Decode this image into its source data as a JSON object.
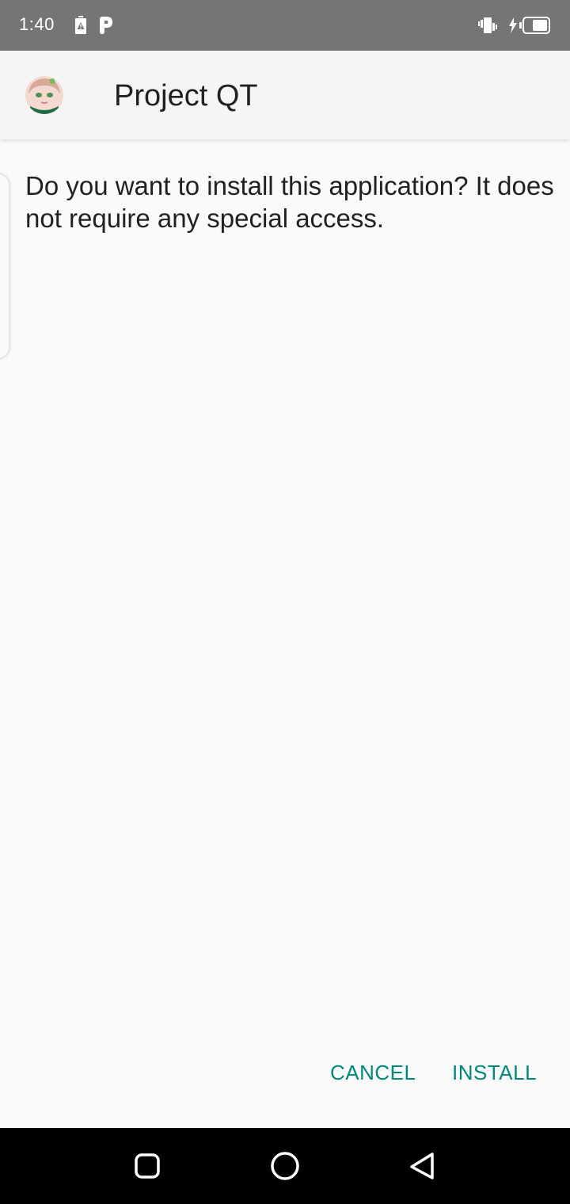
{
  "status_bar": {
    "time": "1:40",
    "icons": [
      "battery-alert-icon",
      "parking-p-icon",
      "vibrate-icon",
      "charging-bolt-icon",
      "battery-icon"
    ]
  },
  "header": {
    "app_icon": "anime-avatar-app-icon",
    "title": "Project QT"
  },
  "content": {
    "message": "Do you want to install this application? It does not require any special access."
  },
  "actions": {
    "cancel_label": "CANCEL",
    "install_label": "INSTALL",
    "accent_color": "#00897b"
  },
  "nav_bar": {
    "buttons": [
      "recents-icon",
      "home-icon",
      "back-icon"
    ]
  }
}
